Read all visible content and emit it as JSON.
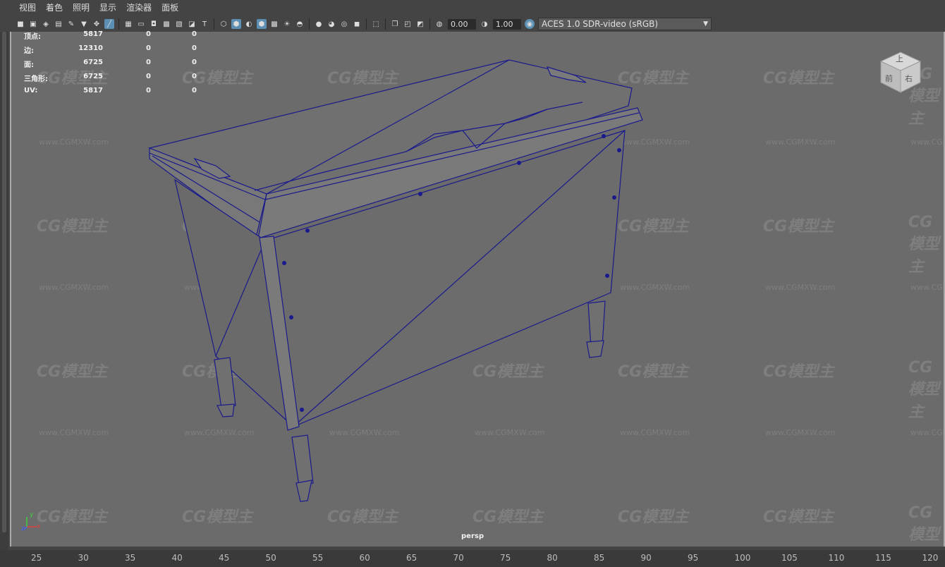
{
  "menu": [
    "视图",
    "着色",
    "照明",
    "显示",
    "渲染器",
    "面板"
  ],
  "toolbar": {
    "exposure": "0.00",
    "gamma": "1.00",
    "color_space": "ACES 1.0 SDR-video (sRGB)"
  },
  "hud": {
    "rows": [
      {
        "label": "顶点:",
        "v1": "5817",
        "v2": "0",
        "v3": "0"
      },
      {
        "label": "边:",
        "v1": "12310",
        "v2": "0",
        "v3": "0"
      },
      {
        "label": "面:",
        "v1": "6725",
        "v2": "0",
        "v3": "0"
      },
      {
        "label": "三角形:",
        "v1": "6725",
        "v2": "0",
        "v3": "0"
      },
      {
        "label": "UV:",
        "v1": "5817",
        "v2": "0",
        "v3": "0"
      }
    ]
  },
  "viewcube": {
    "top": "上",
    "front": "前",
    "right": "右"
  },
  "camera_label": "persp",
  "timeline_ticks": [
    "25",
    "30",
    "35",
    "40",
    "45",
    "50",
    "55",
    "60",
    "65",
    "70",
    "75",
    "80",
    "85",
    "90",
    "95",
    "100",
    "105",
    "110",
    "115",
    "120"
  ],
  "watermark": {
    "logo": "CG模型主",
    "url": "www.CGMXW.com"
  },
  "axis": {
    "x": "x",
    "y": "y",
    "z": "z"
  },
  "colors": {
    "viewport_bg": "#6b6b6b",
    "wireframe": "#1a1a8c",
    "ui_bg": "#444444"
  }
}
